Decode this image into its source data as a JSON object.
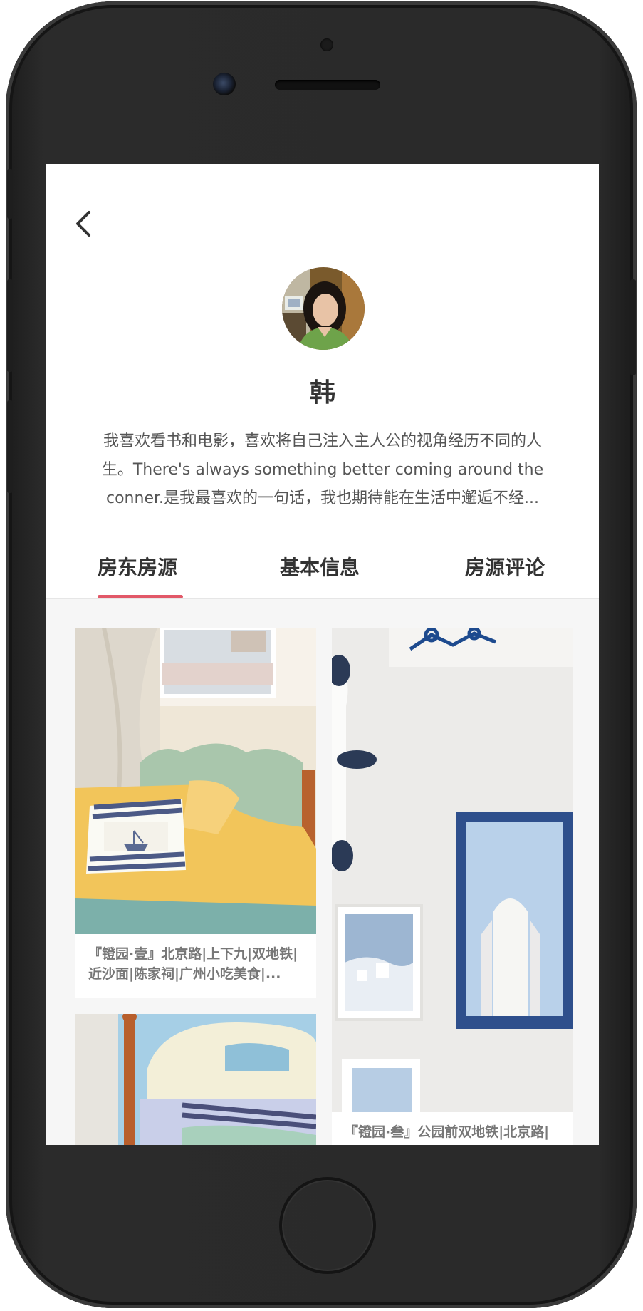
{
  "header": {
    "back_icon": "chevron-left-icon"
  },
  "host": {
    "name": "韩",
    "bio": "我喜欢看书和电影，喜欢将自己注入主人公的视角经历不同的人生。There's always something better coming around the conner.是我最喜欢的一句话，我也期待能在生活中邂逅不经..."
  },
  "tabs": [
    {
      "label": "房东房源",
      "active": true
    },
    {
      "label": "基本信息",
      "active": false
    },
    {
      "label": "房源评论",
      "active": false
    }
  ],
  "listings": [
    {
      "caption": "『镫园·壹』北京路|上下九|双地铁|近沙面|陈家祠|广州小吃美食|..."
    },
    {
      "caption": ""
    },
    {
      "caption": "『镫园·叁』公园前双地铁|北京路|"
    }
  ],
  "colors": {
    "accent": "#e25868",
    "frame": "#262626"
  }
}
